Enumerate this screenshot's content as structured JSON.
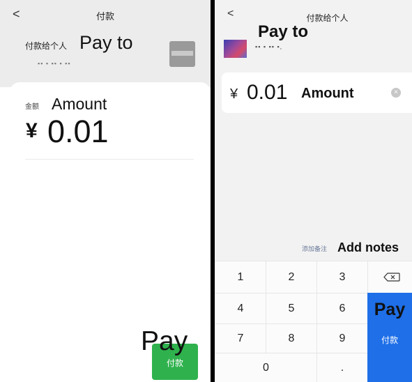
{
  "left": {
    "back_label": "<",
    "title": "付款",
    "payto_cn": "付款给个人",
    "payto_en": "Pay to",
    "payee_masked": "▪▪ ▪ ▪▪ ▪   ▪▪",
    "amount_cn": "金额",
    "amount_en": "Amount",
    "currency": "¥",
    "amount_value": "0.01",
    "pay_overlay": "Pay",
    "pay_button": "付款",
    "accent_color": "#2fb24d"
  },
  "right": {
    "back_label": "<",
    "title": "付款给个人",
    "payto_en": "Pay to",
    "payee_masked": "▪▪  ▪  ▪▪ ▪,",
    "currency": "¥",
    "amount_value": "0.01",
    "amount_en": "Amount",
    "clear_icon": "×",
    "notes_cn": "添加备注",
    "notes_en": "Add notes",
    "keys": {
      "k1": "1",
      "k2": "2",
      "k3": "3",
      "k4": "4",
      "k5": "5",
      "k6": "6",
      "k7": "7",
      "k8": "8",
      "k9": "9",
      "k0": "0",
      "kdot": "."
    },
    "pay_en": "Pay",
    "pay_cn": "付款",
    "accent_color": "#1e6fe8"
  }
}
